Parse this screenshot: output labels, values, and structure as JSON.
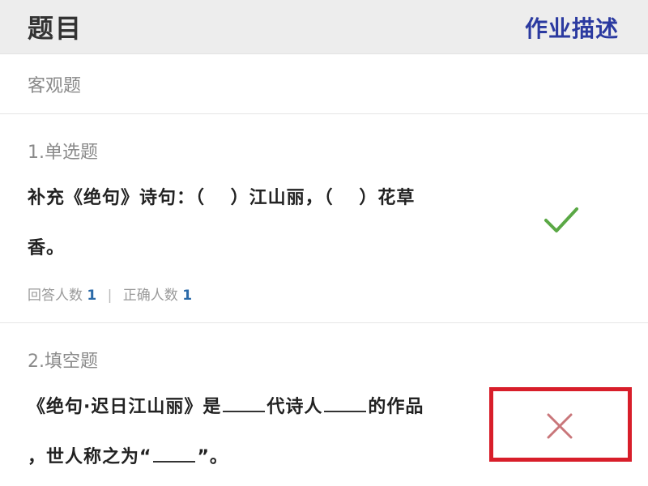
{
  "header": {
    "title": "题目",
    "description_link": "作业描述"
  },
  "section": {
    "label": "客观题"
  },
  "questions": [
    {
      "type_label": "1.单选题",
      "text_line1": "补充《绝句》诗句：（　 ）江山丽，（　 ）花草",
      "text_line2": "香。",
      "stats": {
        "answered_label": "回答人数",
        "answered_count": "1",
        "correct_label": "正确人数",
        "correct_count": "1"
      },
      "status": "correct"
    },
    {
      "type_label": "2.填空题",
      "text_line1_a": "《绝句·迟日江山丽》是",
      "text_line1_b": "代诗人",
      "text_line1_c": "的作品",
      "text_line2_a": "，世人称之为“",
      "text_line2_b": "”。",
      "status": "incorrect"
    }
  ],
  "colors": {
    "correct": "#5aa845",
    "incorrect": "#c9767a",
    "highlight": "#d81e2a",
    "link": "#2b3aa0"
  }
}
